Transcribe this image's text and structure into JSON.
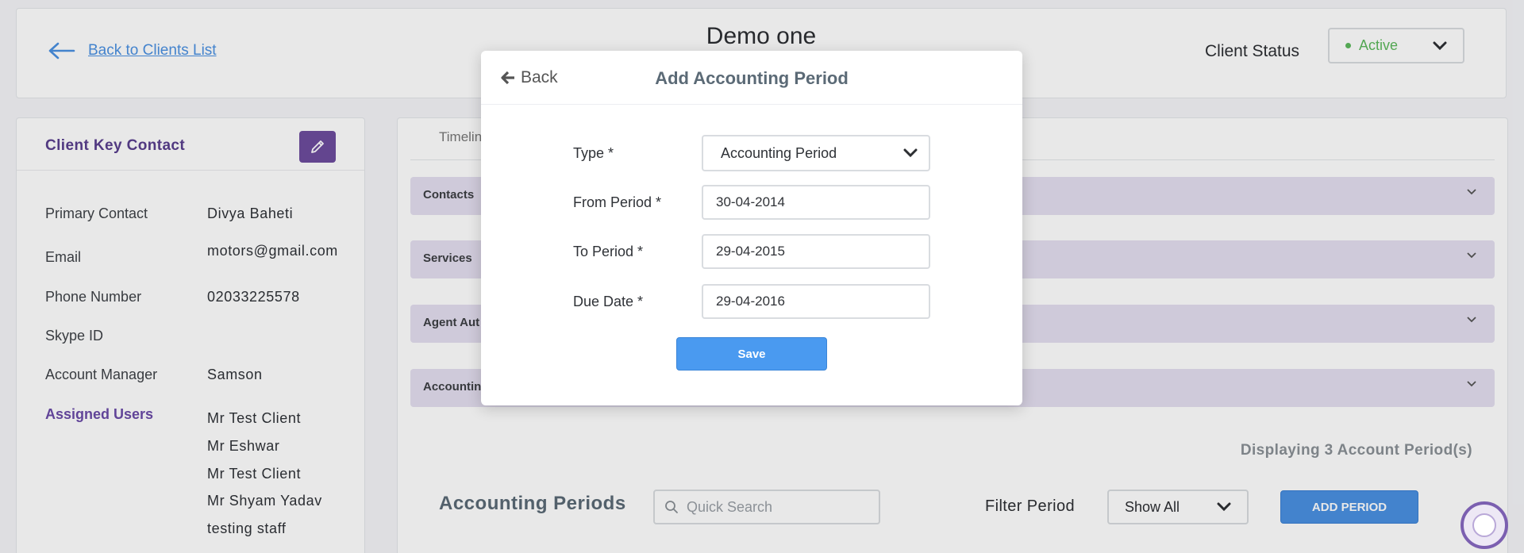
{
  "header": {
    "back_label": "Back to Clients List",
    "client_name": "Demo one",
    "status_label": "Client Status",
    "status_value": "Active"
  },
  "contact": {
    "title": "Client Key Contact",
    "rows": [
      {
        "label": "Primary Contact",
        "value": "Divya Baheti"
      },
      {
        "label": "Email",
        "value": "motors@gmail.com"
      },
      {
        "label": "Phone Number",
        "value": "02033225578"
      },
      {
        "label": "Skype ID",
        "value": ""
      },
      {
        "label": "Account Manager",
        "value": "Samson"
      }
    ],
    "assigned_label": "Assigned Users",
    "assigned_users": [
      "Mr Test Client",
      "Mr Eshwar",
      "Mr Test Client",
      "Mr Shyam Yadav",
      "testing staff"
    ]
  },
  "main": {
    "tab_timeline": "Timelin",
    "accordions": [
      "Contacts",
      "Services",
      "Agent Aut",
      "Accountin"
    ],
    "displaying": "Displaying 3 Account Period(s)",
    "section_title": "Accounting Periods",
    "search_placeholder": "Quick Search",
    "filter_label": "Filter Period",
    "filter_value": "Show All",
    "add_period_label": "ADD PERIOD"
  },
  "modal": {
    "back_label": "Back",
    "title": "Add Accounting Period",
    "type_label": "Type *",
    "type_value": "Accounting Period",
    "from_label": "From Period *",
    "from_value": "30-04-2014",
    "to_label": "To Period *",
    "to_value": "29-04-2015",
    "due_label": "Due Date *",
    "due_value": "29-04-2016",
    "save_label": "Save"
  },
  "colors": {
    "accent_blue": "#4a90e2",
    "purple": "#6d4c9e",
    "active_green": "#5cb85c",
    "accordion_bg": "#e4dff0"
  }
}
